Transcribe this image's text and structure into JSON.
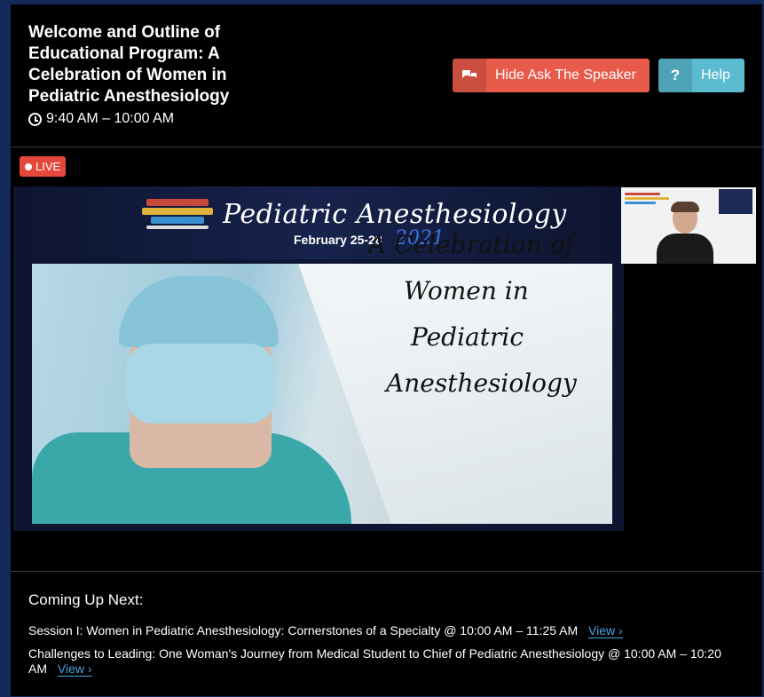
{
  "session": {
    "title": "Welcome and Outline of Educational Program: A Celebration of Women in Pediatric Anesthesiology",
    "time": "9:40 AM – 10:00 AM"
  },
  "buttons": {
    "ask_label": "Hide Ask The Speaker",
    "help_label": "Help",
    "help_glyph": "?"
  },
  "live_label": "LIVE",
  "slide": {
    "conference_title": "Pediatric Anesthesiology",
    "dates": "February 25-28",
    "year": "2021",
    "headline": [
      "A Celebration of",
      "Women in",
      "Pediatric",
      "Anesthesiology"
    ]
  },
  "coming_up": {
    "heading": "Coming Up Next:",
    "view_label": "View ›",
    "items": [
      {
        "text": "Session I: Women in Pediatric Anesthesiology: Cornerstones of a Specialty @ 10:00 AM – 11:25 AM"
      },
      {
        "text": "Challenges to Leading: One Woman's Journey from Medical Student to Chief of Pediatric Anesthesiology @ 10:00 AM – 10:20 AM"
      }
    ]
  },
  "colors": {
    "ask_button": "#e85a4a",
    "help_button": "#5bbcd1",
    "live_badge": "#e5483b",
    "link": "#4aa3df",
    "page_border": "#14285a"
  }
}
